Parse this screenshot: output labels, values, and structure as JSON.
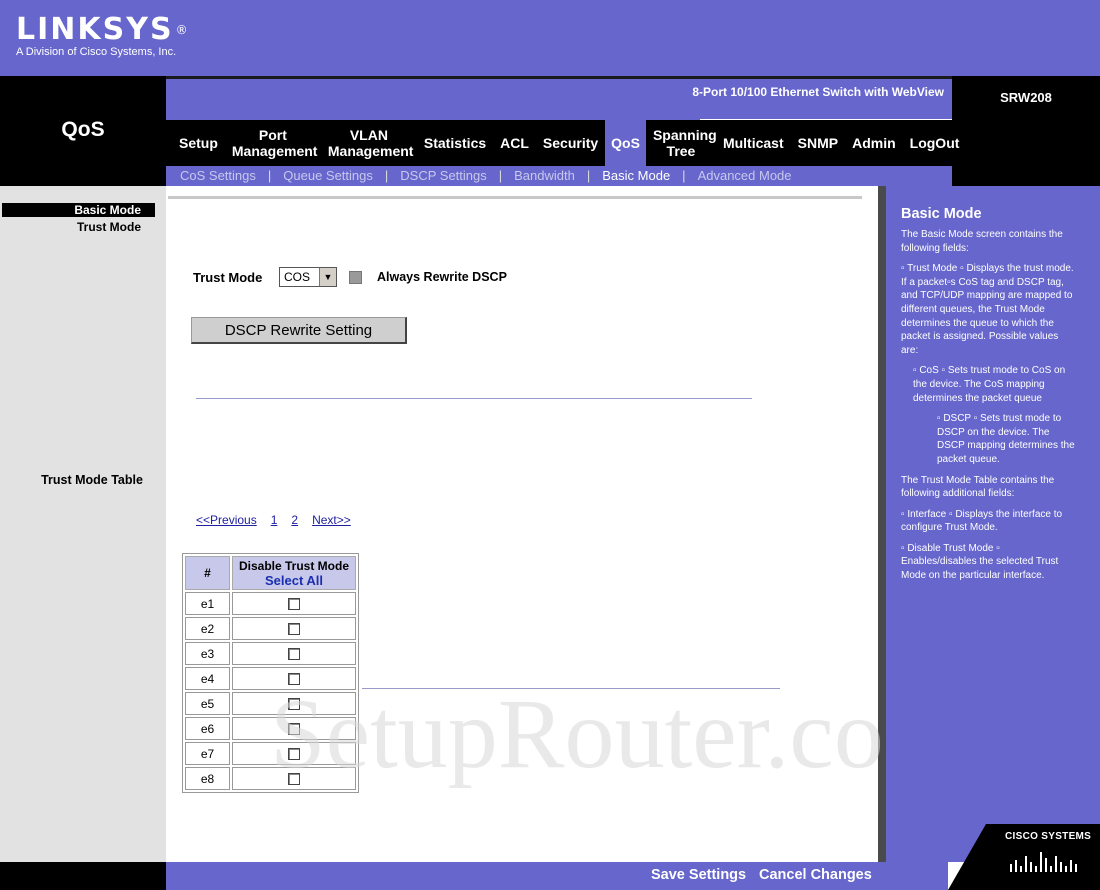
{
  "brand": {
    "logo_text": "LINKSYS",
    "logo_reg": "®",
    "logo_tagline": "A Division of Cisco Systems, Inc.",
    "product_name": "8-Port 10/100 Ethernet Switch with WebView",
    "model": "SRW208",
    "section_title": "QoS",
    "cisco_text": "CISCO SYSTEMS"
  },
  "nav": {
    "items": [
      {
        "label": "Setup"
      },
      {
        "label": "Port Management"
      },
      {
        "label": "VLAN Management"
      },
      {
        "label": "Statistics"
      },
      {
        "label": "ACL"
      },
      {
        "label": "Security"
      },
      {
        "label": "QoS"
      },
      {
        "label": "Spanning Tree"
      },
      {
        "label": "Multicast"
      },
      {
        "label": "SNMP"
      },
      {
        "label": "Admin"
      },
      {
        "label": "LogOut"
      }
    ],
    "active": "QoS"
  },
  "subnav": {
    "items": [
      {
        "label": "CoS Settings"
      },
      {
        "label": "Queue Settings"
      },
      {
        "label": "DSCP Settings"
      },
      {
        "label": "Bandwidth"
      },
      {
        "label": "Basic Mode"
      },
      {
        "label": "Advanced Mode"
      }
    ],
    "separator": "|",
    "active": "Basic Mode"
  },
  "sidebar": {
    "items": [
      {
        "label": "Basic Mode"
      },
      {
        "label": "Trust Mode"
      },
      {
        "label": "Trust Mode Table"
      }
    ]
  },
  "form": {
    "trust_mode_label": "Trust Mode",
    "trust_mode_value": "COS",
    "always_rewrite_label": "Always Rewrite DSCP",
    "dscp_button_label": "DSCP Rewrite Setting"
  },
  "pager": {
    "prev": "<<Previous",
    "pages": [
      "1",
      "2"
    ],
    "next": "Next>>"
  },
  "table": {
    "col_num": "#",
    "col_disable": "Disable Trust Mode",
    "select_all": "Select All",
    "rows": [
      "e1",
      "e2",
      "e3",
      "e4",
      "e5",
      "e6",
      "e7",
      "e8"
    ]
  },
  "help": {
    "title": "Basic Mode",
    "intro": "The Basic Mode screen contains the following fields:",
    "trust_mode": "▫ Trust Mode ▫ Displays the trust mode. If a packet▫s CoS tag and DSCP tag, and TCP/UDP mapping are mapped to different queues, the Trust Mode determines the queue to which the packet is assigned. Possible values are:",
    "cos": "▫ CoS ▫ Sets trust mode to CoS on the device. The CoS mapping determines the packet queue",
    "dscp": "▫ DSCP ▫ Sets trust mode to DSCP on the device. The DSCP mapping determines the packet queue.",
    "table_intro": "The Trust Mode Table contains the following additional fields:",
    "interface": "▫ Interface ▫ Displays the interface to configure Trust Mode.",
    "disable": "▫ Disable Trust Mode ▫ Enables/disables the selected Trust Mode on the particular interface."
  },
  "footer": {
    "save": "Save Settings",
    "cancel": "Cancel Changes"
  },
  "watermark": "SetupRouter.com",
  "colors": {
    "brand_purple": "#6666cc",
    "black": "#000000",
    "link_blue": "#2020a0",
    "table_header": "#c8c8ea"
  }
}
